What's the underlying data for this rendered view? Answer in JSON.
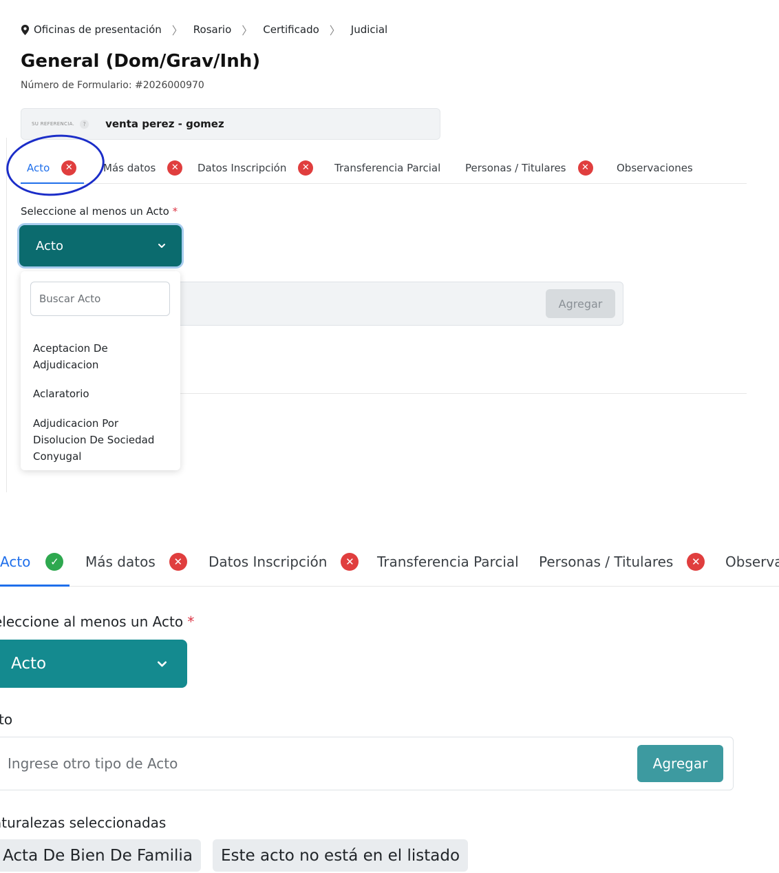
{
  "breadcrumb": {
    "items": [
      "Oficinas de presentación",
      "Rosario",
      "Certificado",
      "Judicial"
    ],
    "separator": ">"
  },
  "header": {
    "title": "General (Dom/Grav/Inh)",
    "form_number": "Número de Formulario: #2026000970"
  },
  "reference": {
    "label": "SU REFERENCIA.",
    "help": "?",
    "value": "venta perez - gomez"
  },
  "tabs_top": [
    {
      "label": "Acto",
      "status": "error",
      "active": true
    },
    {
      "label": "Más datos",
      "status": "error"
    },
    {
      "label": "Datos Inscripción",
      "status": "error"
    },
    {
      "label": "Transferencia Parcial",
      "status": "none"
    },
    {
      "label": "Personas / Titulares",
      "status": "error"
    },
    {
      "label": "Observaciones",
      "status": "none"
    }
  ],
  "top_form": {
    "select_label": "Seleccione al menos un Acto",
    "required_mark": "*",
    "dropdown_button": "Acto",
    "add_button": "Agregar",
    "dropdown": {
      "search_placeholder": "Buscar Acto",
      "options": [
        "Aceptacion De Adjudicacion",
        "Aclaratorio",
        "Adjudicacion Por Disolucion De Sociedad Conyugal"
      ]
    }
  },
  "tabs_bottom": [
    {
      "label": "Acto",
      "status": "ok",
      "active": true
    },
    {
      "label": "Más datos",
      "status": "error"
    },
    {
      "label": "Datos Inscripción",
      "status": "error"
    },
    {
      "label": "Transferencia Parcial",
      "status": "none"
    },
    {
      "label": "Personas / Titulares",
      "status": "error"
    },
    {
      "label": "Observa",
      "status": "none"
    }
  ],
  "bottom_form": {
    "select_label": "eleccione al menos un Acto",
    "required_mark": "*",
    "dropdown_button": "Acto",
    "other_label": "cto",
    "other_placeholder": "Ingrese otro tipo de Acto",
    "add_button": "Agregar",
    "selected_label": "aturalezas seleccionadas",
    "selected_chips": [
      "Acta De Bien De Familia",
      "Este acto no está en el listado"
    ]
  },
  "icons": {
    "status_error": "✕",
    "status_ok": "✓"
  },
  "colors": {
    "accent": "#1f6feb",
    "teal_dark": "#0b6b6e",
    "teal": "#148a8f",
    "error": "#e03e3e",
    "ok": "#2ea84f",
    "annotation": "#1b2dc8"
  }
}
